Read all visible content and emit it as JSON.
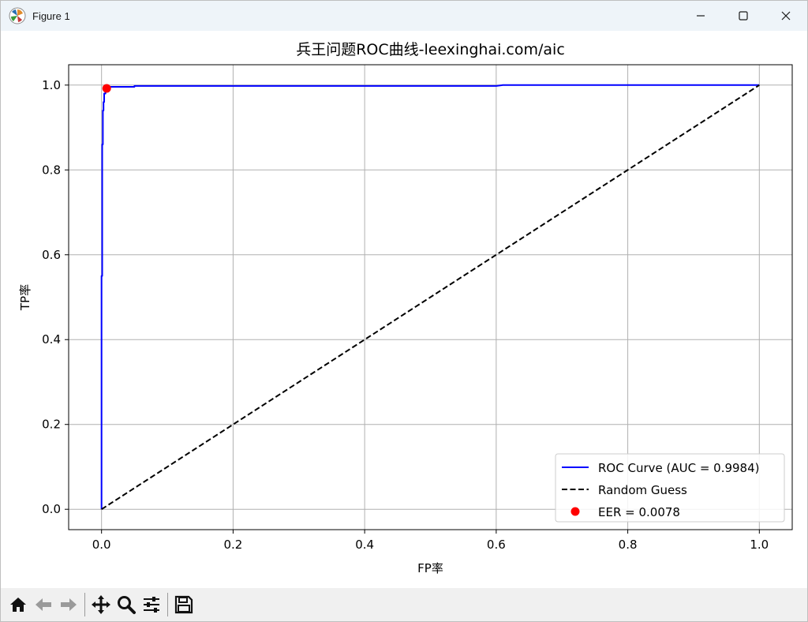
{
  "window": {
    "title": "Figure 1",
    "icons": {
      "app": "matplotlib-icon",
      "minimize": "minimize-icon",
      "maximize": "maximize-icon",
      "close": "close-icon"
    }
  },
  "toolbar": {
    "items": [
      {
        "name": "home-button",
        "icon": "home-icon",
        "label": ""
      },
      {
        "name": "back-button",
        "icon": "arrow-left-icon",
        "label": ""
      },
      {
        "name": "forward-button",
        "icon": "arrow-right-icon",
        "label": ""
      },
      {
        "name": "pan-button",
        "icon": "move-icon",
        "label": ""
      },
      {
        "name": "zoom-button",
        "icon": "magnifier-icon",
        "label": ""
      },
      {
        "name": "configure-subplots-button",
        "icon": "sliders-icon",
        "label": ""
      },
      {
        "name": "save-button",
        "icon": "floppy-disk-icon",
        "label": ""
      }
    ]
  },
  "colors": {
    "roc": "#0000ff",
    "random": "#000000",
    "eer": "#ff0000",
    "grid": "#b0b0b0"
  },
  "chart_data": {
    "type": "line",
    "title": "兵王问题ROC曲线-leexinghai.com/aic",
    "xlabel": "FP率",
    "ylabel": "TP率",
    "xlim": [
      -0.05,
      1.05
    ],
    "ylim": [
      -0.048,
      1.048
    ],
    "xticks": [
      0.0,
      0.2,
      0.4,
      0.6,
      0.8,
      1.0
    ],
    "yticks": [
      0.0,
      0.2,
      0.4,
      0.6,
      0.8,
      1.0
    ],
    "xtick_labels": [
      "0.0",
      "0.2",
      "0.4",
      "0.6",
      "0.8",
      "1.0"
    ],
    "ytick_labels": [
      "0.0",
      "0.2",
      "0.4",
      "0.6",
      "0.8",
      "1.0"
    ],
    "grid": true,
    "legend_position": "lower-right",
    "series": [
      {
        "name": "ROC Curve (AUC = 0.9984)",
        "style": "solid",
        "x": [
          0.0,
          0.0,
          0.001,
          0.001,
          0.002,
          0.002,
          0.003,
          0.003,
          0.004,
          0.004,
          0.006,
          0.006,
          0.008,
          0.008,
          0.012,
          0.012,
          0.02,
          0.05,
          0.05,
          0.6,
          0.61,
          1.0
        ],
        "y": [
          0.0,
          0.55,
          0.55,
          0.86,
          0.86,
          0.94,
          0.94,
          0.96,
          0.96,
          0.98,
          0.98,
          0.99,
          0.99,
          0.994,
          0.994,
          0.996,
          0.996,
          0.996,
          0.998,
          0.998,
          1.0,
          1.0
        ]
      },
      {
        "name": "Random Guess",
        "style": "dashed",
        "x": [
          0.0,
          1.0
        ],
        "y": [
          0.0,
          1.0
        ]
      },
      {
        "name": "EER = 0.0078",
        "style": "marker",
        "x": [
          0.0078
        ],
        "y": [
          0.9922
        ]
      }
    ]
  }
}
